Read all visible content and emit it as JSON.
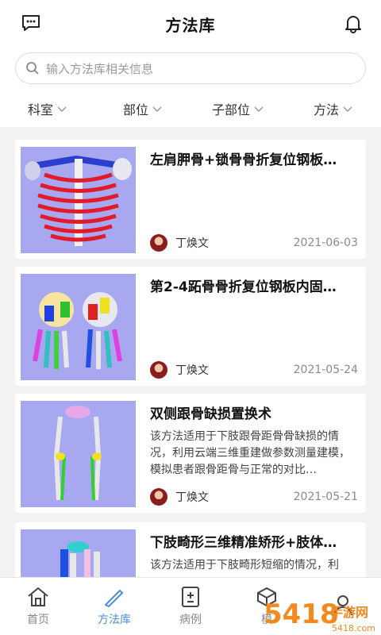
{
  "header": {
    "title": "方法库",
    "left_icon": "chat-icon",
    "right_icon": "bell-icon"
  },
  "search": {
    "placeholder": "输入方法库相关信息"
  },
  "filters": [
    {
      "label": "科室"
    },
    {
      "label": "部位"
    },
    {
      "label": "子部位"
    },
    {
      "label": "方法"
    }
  ],
  "cards": [
    {
      "title": "左肩胛骨+锁骨骨折复位钢板…",
      "description": "",
      "author": "丁焕文",
      "date": "2021-06-03"
    },
    {
      "title": "第2-4跖骨骨折复位钢板内固…",
      "description": "",
      "author": "丁焕文",
      "date": "2021-05-24"
    },
    {
      "title": "双侧跟骨缺损置换术",
      "description": "该方法适用于下肢跟骨距骨骨缺损的情况，利用云端三维重建做参数测量建模，模拟患者跟骨距骨与正常的对比…",
      "author": "丁焕文",
      "date": "2021-05-21"
    },
    {
      "title": "下肢畸形三维精准矫形+肢体…",
      "description": "该方法适用于下肢畸形短缩的情况，利",
      "author": "",
      "date": ""
    }
  ],
  "tabbar": [
    {
      "label": "首页",
      "icon": "home-icon"
    },
    {
      "label": "方法库",
      "icon": "scalpel-icon",
      "active": true
    },
    {
      "label": "病例",
      "icon": "case-icon"
    },
    {
      "label": "模",
      "icon": "model-icon"
    },
    {
      "label": "",
      "icon": "user-icon"
    }
  ],
  "watermark": {
    "text": "5418手游网",
    "sub": "5418.com"
  },
  "colors": {
    "accent": "#4a90d9",
    "thumb_bg": "#a8a8f0",
    "watermark": "#f28a1f"
  }
}
